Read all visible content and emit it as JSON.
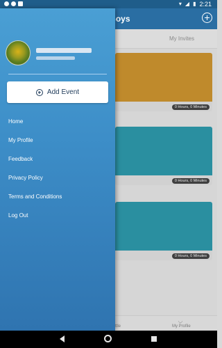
{
  "status_bar": {
    "time": "2:21",
    "icons": [
      "wifi-icon",
      "signal-icon",
      "battery-icon"
    ]
  },
  "app_bar": {
    "title": "Pindi Boys",
    "menu_icon": "menu-icon",
    "add_icon": "add-circle-icon"
  },
  "tabs": {
    "left_partial": "s",
    "right": "My Invites"
  },
  "cards": [
    {
      "duration": "0 Hours, 0 Minutes"
    },
    {
      "duration": "0 Hours, 0 Minutes"
    },
    {
      "duration": "0 Hours, 0 Minutes"
    }
  ],
  "bottom_nav": {
    "left_partial": "ttle",
    "right": "My Profile"
  },
  "drawer": {
    "add_event_label": "Add Event",
    "menu": [
      "Home",
      "My Profile",
      "Feedback",
      "Privacy Policy",
      "Terms and Conditions",
      "Log Out"
    ]
  },
  "colors": {
    "app_bar": "#2a6ea3",
    "drawer_top": "#4a9fd4",
    "drawer_bottom": "#2f74b0"
  }
}
